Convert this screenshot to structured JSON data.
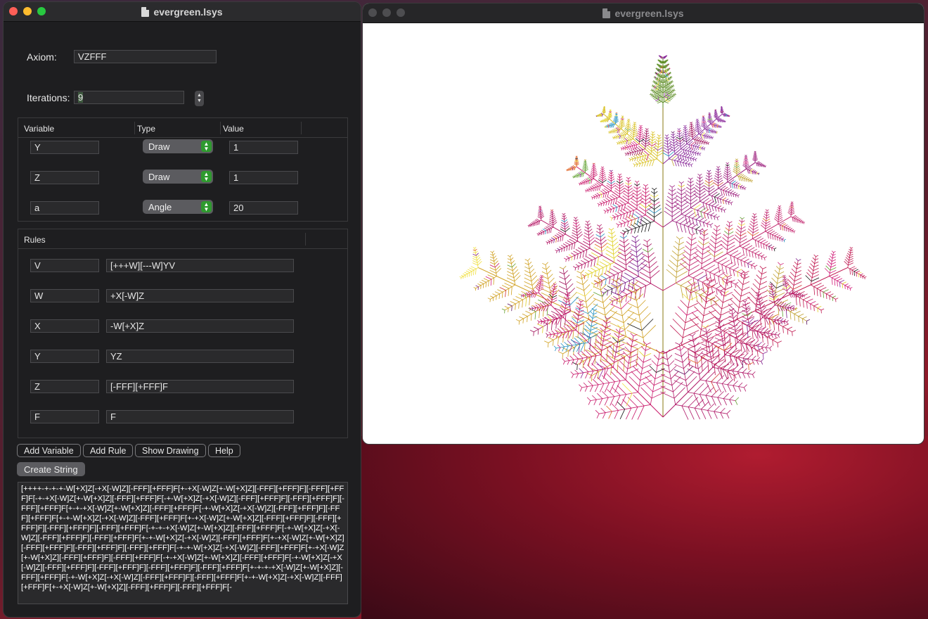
{
  "window_title": "evergreen.lsys",
  "drawing_window_title": "evergreen.lsys",
  "axiom": {
    "label": "Axiom:",
    "value": "VZFFF"
  },
  "iterations": {
    "label": "Iterations:",
    "value": "9"
  },
  "variables_table": {
    "headers": {
      "variable": "Variable",
      "type": "Type",
      "value": "Value"
    },
    "rows": [
      {
        "variable": "Y",
        "type": "Draw",
        "value": "1"
      },
      {
        "variable": "Z",
        "type": "Draw",
        "value": "1"
      },
      {
        "variable": "a",
        "type": "Angle",
        "value": "20"
      }
    ]
  },
  "rules_table": {
    "header": "Rules",
    "rows": [
      {
        "symbol": "V",
        "replacement": "[+++W][---W]YV"
      },
      {
        "symbol": "W",
        "replacement": "+X[-W]Z"
      },
      {
        "symbol": "X",
        "replacement": "-W[+X]Z"
      },
      {
        "symbol": "Y",
        "replacement": "YZ"
      },
      {
        "symbol": "Z",
        "replacement": "[-FFF][+FFF]F"
      },
      {
        "symbol": "F",
        "replacement": "F"
      }
    ]
  },
  "buttons": {
    "add_variable": "Add Variable",
    "add_rule": "Add Rule",
    "show_drawing": "Show Drawing",
    "help": "Help",
    "create_string": "Create String"
  },
  "output_string": "[++++-+-+-+-W[+X]Z[-+X[-W]Z][-FFF][+FFF]F[+-+X[-W]Z[+-W[+X]Z][-FFF][+FFF]F][-FFF][+FFF]F[-+-+X[-W]Z[+-W[+X]Z][-FFF][+FFF]F[-+-W[+X]Z[-+X[-W]Z][-FFF][+FFF]F][-FFF][+FFF]F][-FFF][+FFF]F[+-+-+X[-W]Z[+-W[+X]Z][-FFF][+FFF]F[-+-W[+X]Z[-+X[-W]Z][-FFF][+FFF]F][-FFF][+FFF]F[+-+-W[+X]Z[-+X[-W]Z][-FFF][+FFF]F[+-+X[-W]Z[+-W[+X]Z][-FFF][+FFF]F][-FFF][+FFF]F][-FFF][+FFF]F][-FFF][+FFF]F[-+-+-+X[-W]Z[+-W[+X]Z][-FFF][+FFF]F[-+-W[+X]Z[-+X[-W]Z][-FFF][+FFF]F][-FFF][+FFF]F[+-+-W[+X]Z[-+X[-W]Z][-FFF][+FFF]F[+-+X[-W]Z[+-W[+X]Z][-FFF][+FFF]F][-FFF][+FFF]F][-FFF][+FFF]F[-+-+-W[+X]Z[-+X[-W]Z][-FFF][+FFF]F[+-+X[-W]Z[+-W[+X]Z][-FFF][+FFF]F][-FFF][+FFF]F[-+-+X[-W]Z[+-W[+X]Z][-FFF][+FFF]F[-+-W[+X]Z[-+X[-W]Z][-FFF][+FFF]F][-FFF][+FFF]F][-FFF][+FFF]F][-FFF][+FFF]F[+-+-+-+X[-W]Z[+-W[+X]Z][-FFF][+FFF]F[-+-W[+X]Z[-+X[-W]Z][-FFF][+FFF]F][-FFF][+FFF]F[+-+-W[+X]Z[-+X[-W]Z][-FFF][+FFF]F[+-+X[-W]Z[+-W[+X]Z][-FFF][+FFF]F][-FFF][+FFF]F[-",
  "colors": {
    "window_bg": "#1e1e20",
    "canvas_bg": "#ffffff",
    "popup_arrow": "#2f9a2f"
  }
}
